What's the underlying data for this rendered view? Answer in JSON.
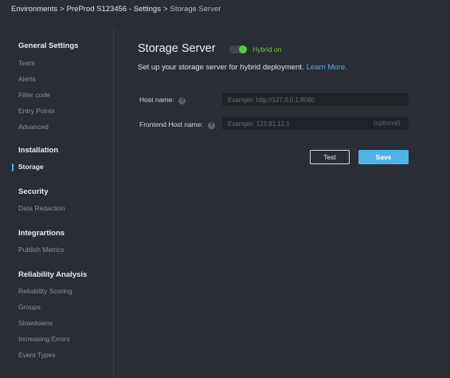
{
  "breadcrumb": {
    "items": [
      "Environments",
      "PreProd S123456 - Settings"
    ],
    "separator": ">",
    "current": "Storage Server"
  },
  "sidebar": {
    "sections": [
      {
        "title": "General Settings",
        "items": [
          "Team",
          "Alerts",
          "Filter code",
          "Entry Points",
          "Advanced"
        ]
      },
      {
        "title": "Installation",
        "items": [
          "Storage"
        ]
      },
      {
        "title": "Security",
        "items": [
          "Data Redaction"
        ]
      },
      {
        "title": "Integrartions",
        "items": [
          "Publish Metrics"
        ]
      },
      {
        "title": "Reliability Analysis",
        "items": [
          "Reliability Scoring",
          "Groups",
          "Slowdowns",
          "Increasing Errors",
          "Event Types"
        ]
      }
    ],
    "active_item": "Storage"
  },
  "main": {
    "title": "Storage Server",
    "toggle": {
      "label": "Hybrid on",
      "on": true
    },
    "subtitle": "Set up your storage server for hybrid deployment.",
    "learn_more": "Learn More.",
    "fields": [
      {
        "label": "Host name:",
        "help": "?",
        "value": "",
        "placeholder": "Example: http://127.0.0.1:8080"
      },
      {
        "label": "Frontend Host name:",
        "help": "?",
        "value": "",
        "placeholder": "Example: 123.91.12.1",
        "hint": "(optional)"
      }
    ],
    "buttons": {
      "test": "Test",
      "save": "Save"
    }
  },
  "colors": {
    "background": "#2a2d33",
    "accent": "#4fb3e8",
    "toggle_on": "#62c83c",
    "input_bg": "#1f2226"
  }
}
